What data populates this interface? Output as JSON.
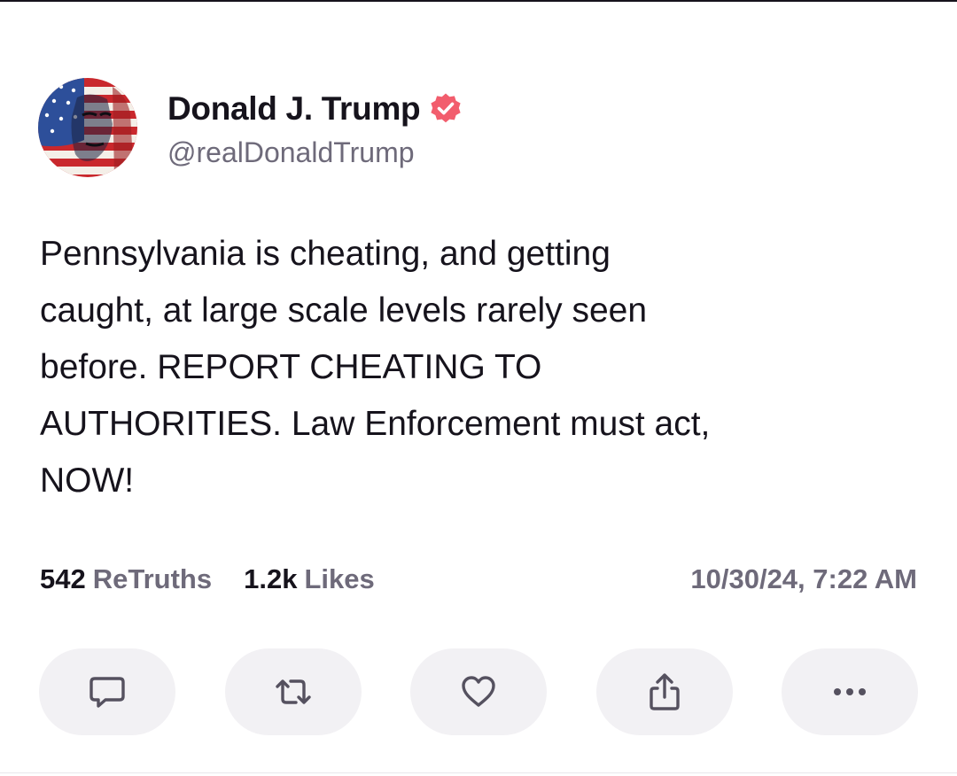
{
  "post": {
    "author": {
      "display_name": "Donald J. Trump",
      "handle": "@realDonaldTrump",
      "verified": true,
      "verified_badge_color": "#f25d6d"
    },
    "text": "Pennsylvania is cheating, and getting\ncaught, at large scale levels rarely seen\nbefore. REPORT CHEATING TO\nAUTHORITIES. Law Enforcement must act,\nNOW!",
    "stats": {
      "retruths_count": "542",
      "retruths_label": "ReTruths",
      "likes_count": "1.2k",
      "likes_label": "Likes",
      "timestamp": "10/30/24, 7:22 AM"
    },
    "actions": [
      {
        "name": "reply",
        "icon": "speech-bubble-icon"
      },
      {
        "name": "retruth",
        "icon": "repost-arrows-icon"
      },
      {
        "name": "like",
        "icon": "heart-icon"
      },
      {
        "name": "share",
        "icon": "share-upload-icon"
      },
      {
        "name": "more",
        "icon": "ellipsis-icon"
      }
    ]
  },
  "colors": {
    "text_primary": "#16131c",
    "text_secondary": "#6e6a7a",
    "button_background": "#f2f1f4"
  }
}
